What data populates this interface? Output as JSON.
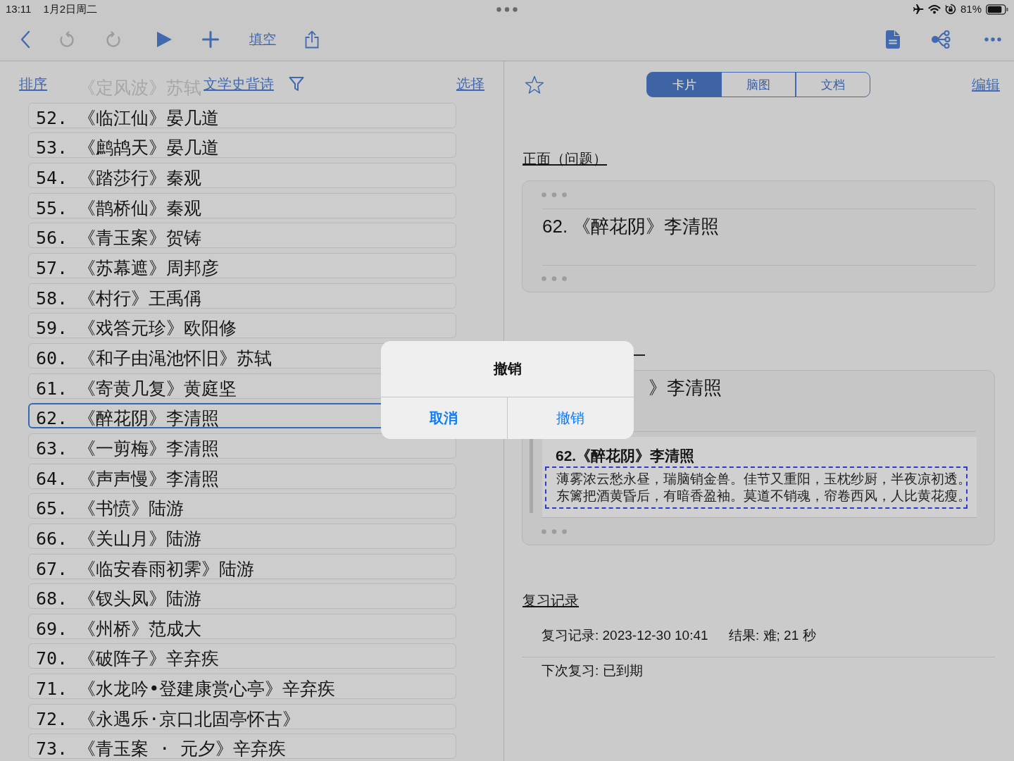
{
  "status_bar": {
    "time": "13:11",
    "date": "1月2日周二",
    "battery": "81%"
  },
  "toolbar": {
    "left": [
      {
        "kind": "back",
        "disabled": false
      },
      {
        "kind": "undo",
        "disabled": true
      },
      {
        "kind": "redo",
        "disabled": true
      },
      {
        "kind": "play",
        "disabled": false
      },
      {
        "kind": "add",
        "disabled": false
      },
      {
        "kind": "link",
        "label": "填空",
        "disabled": false
      },
      {
        "kind": "share",
        "disabled": false
      }
    ],
    "right": [
      {
        "kind": "document"
      },
      {
        "kind": "mindmap"
      },
      {
        "kind": "more"
      }
    ]
  },
  "list": {
    "sort": "排序",
    "title": "文学史背诗",
    "select": "选择",
    "behind_header": "《定风波》苏轼",
    "rows": [
      {
        "label": "52. 《临江仙》晏几道",
        "selected": false
      },
      {
        "label": "53. 《鹧鸪天》晏几道",
        "selected": false
      },
      {
        "label": "54. 《踏莎行》秦观",
        "selected": false
      },
      {
        "label": "55. 《鹊桥仙》秦观",
        "selected": false
      },
      {
        "label": "56. 《青玉案》贺铸",
        "selected": false
      },
      {
        "label": "57. 《苏幕遮》周邦彦",
        "selected": false
      },
      {
        "label": "58. 《村行》王禹偁",
        "selected": false
      },
      {
        "label": "59. 《戏答元珍》欧阳修",
        "selected": false
      },
      {
        "label": "60. 《和子由渑池怀旧》苏轼",
        "selected": false
      },
      {
        "label": "61. 《寄黄几复》黄庭坚",
        "selected": false
      },
      {
        "label": "62. 《醉花阴》李清照",
        "selected": true
      },
      {
        "label": "63. 《一剪梅》李清照",
        "selected": false
      },
      {
        "label": "64. 《声声慢》李清照",
        "selected": false
      },
      {
        "label": "65. 《书愤》陆游",
        "selected": false
      },
      {
        "label": "66. 《关山月》陆游",
        "selected": false
      },
      {
        "label": "67. 《临安春雨初霁》陆游",
        "selected": false
      },
      {
        "label": "68. 《钗头凤》陆游",
        "selected": false
      },
      {
        "label": "69. 《州桥》范成大",
        "selected": false
      },
      {
        "label": "70. 《破阵子》辛弃疾",
        "selected": false
      },
      {
        "label": "71. 《水龙吟•登建康赏心亭》辛弃疾",
        "selected": false
      },
      {
        "label": "72. 《永遇乐·京口北固亭怀古》",
        "selected": false
      },
      {
        "label": "73. 《青玉案 · 元夕》辛弃疾",
        "selected": false
      }
    ]
  },
  "detail": {
    "starred": false,
    "tabs": [
      {
        "label": "卡片",
        "selected": true
      },
      {
        "label": "脑图",
        "selected": false
      },
      {
        "label": "文档",
        "selected": false
      }
    ],
    "edit": "编辑",
    "front": {
      "heading": "正面（问题）",
      "text": "62. 《醉花阴》李清照"
    },
    "back": {
      "text": "》李清照",
      "excerpt_title": "62.《醉花阴》李清照",
      "excerpt_lines": [
        "薄雾浓云愁永昼，瑞脑销金兽。佳节又重阳，玉枕纱厨，半夜凉初透。",
        "东篱把酒黄昏后，有暗香盈袖。莫道不销魂，帘卷西风，人比黄花瘦。"
      ]
    },
    "review": {
      "heading": "复习记录",
      "record": "复习记录: 2023-12-30 10:41",
      "result": "结果: 难; 21 秒",
      "next": "下次复习: 已到期"
    }
  },
  "dialog": {
    "title": "撤销",
    "buttons": [
      {
        "label": "取消",
        "kind": "cancel"
      },
      {
        "label": "撤销",
        "kind": "confirm"
      }
    ]
  }
}
